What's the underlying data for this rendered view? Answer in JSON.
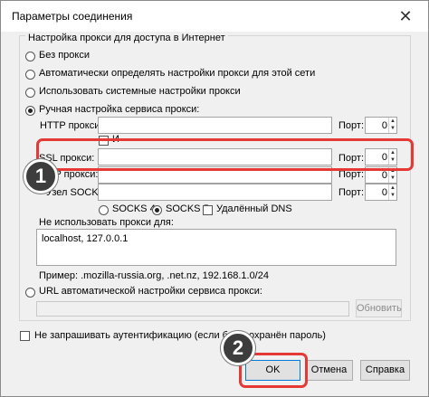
{
  "window": {
    "title": "Параметры соединения",
    "close_glyph": "✕"
  },
  "proxy_group": {
    "legend": "Настройка прокси для доступа в Интернет",
    "options": [
      {
        "label": "Без прокси",
        "checked": false
      },
      {
        "label": "Автоматически определять настройки прокси для этой сети",
        "checked": false
      },
      {
        "label": "Использовать системные настройки прокси",
        "checked": false
      },
      {
        "label": "Ручная настройка сервиса прокси:",
        "checked": true
      }
    ],
    "http": {
      "label": "HTTP прокси:",
      "value": "",
      "port_label": "Порт:",
      "port": "0"
    },
    "share_checkbox_label": "И",
    "ssl": {
      "label": "SSL прокси:",
      "value": "",
      "port_label": "Порт:",
      "port": "0"
    },
    "ftp": {
      "label": "FTP прокси:",
      "value": "",
      "port_label": "Порт:",
      "port": "0"
    },
    "socks": {
      "label": "Узел SOCKS:",
      "value": "",
      "port_label": "Порт:",
      "port": "0"
    },
    "socks4_label": "SOCKS 4",
    "socks5_label": "SOCKS 5",
    "remote_dns_label": "Удалённый DNS",
    "no_proxy_label": "Не использовать прокси для:",
    "no_proxy_value": "localhost, 127.0.0.1",
    "example": "Пример: .mozilla-russia.org, .net.nz, 192.168.1.0/24",
    "auto_url_label": "URL автоматической настройки сервиса прокси:",
    "auto_url_value": "",
    "reload_button": "Обновить"
  },
  "no_auth_label": "Не запрашивать аутентификацию (если был сохранён пароль)",
  "buttons": {
    "ok": "OK",
    "cancel": "Отмена",
    "help": "Справка"
  },
  "annotations": {
    "step1": "1",
    "step2": "2",
    "highlight_color": "#e53935",
    "badge_color": "#3d3d3d"
  }
}
